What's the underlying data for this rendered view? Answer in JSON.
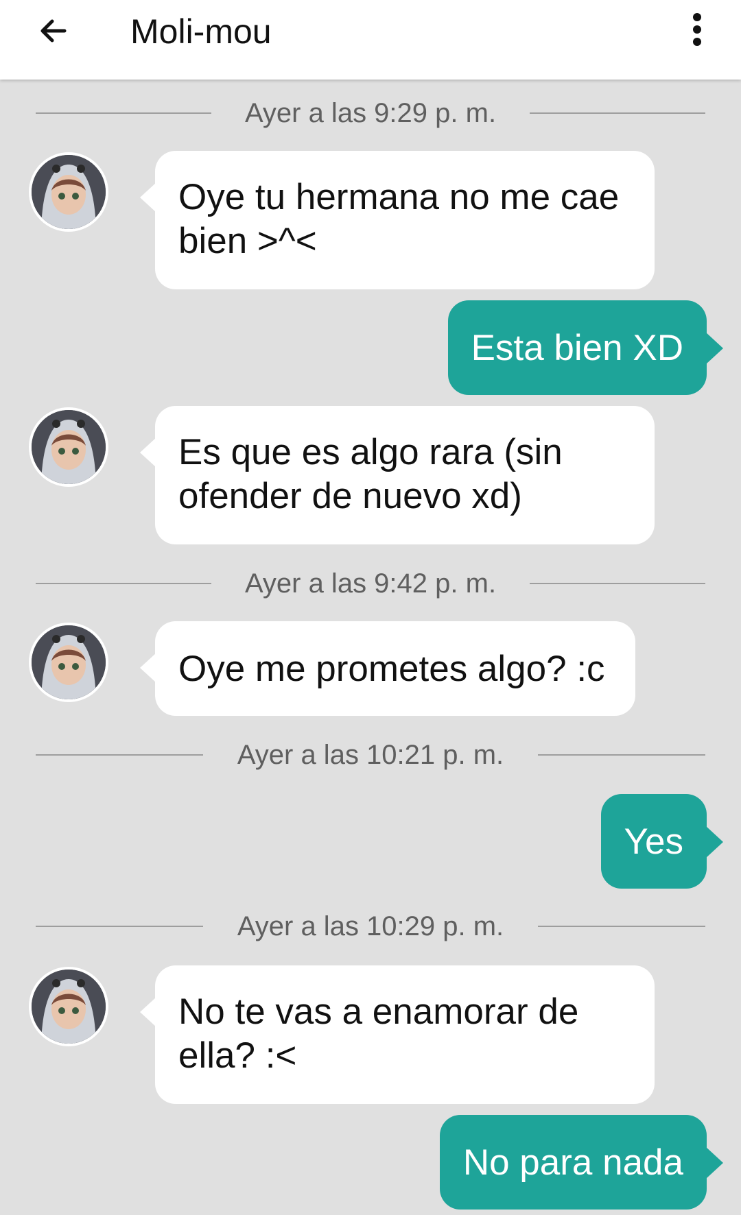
{
  "header": {
    "back_icon": "arrow-back-icon",
    "title": "Moli-mou",
    "menu_icon": "more-vert-icon"
  },
  "colors": {
    "background": "#e0e0e0",
    "header": "#ffffff",
    "incoming_bubble": "#ffffff",
    "outgoing_bubble": "#1ea499",
    "timestamp_text": "#5f5f5f"
  },
  "conversation": {
    "ts1": "Ayer a las 9:29 p. m.",
    "m1": "Oye tu hermana no me cae bien >^<",
    "m2": "Esta bien XD",
    "m3": "Es que es algo rara (sin ofender de nuevo xd)",
    "ts2": "Ayer a las 9:42 p. m.",
    "m4": "Oye me prometes algo? :c",
    "ts3": "Ayer a las 10:21 p. m.",
    "m5": "Yes",
    "ts4": "Ayer a las 10:29 p. m.",
    "m6": "No te vas a enamorar de ella? :<",
    "m7": "No para nada"
  }
}
